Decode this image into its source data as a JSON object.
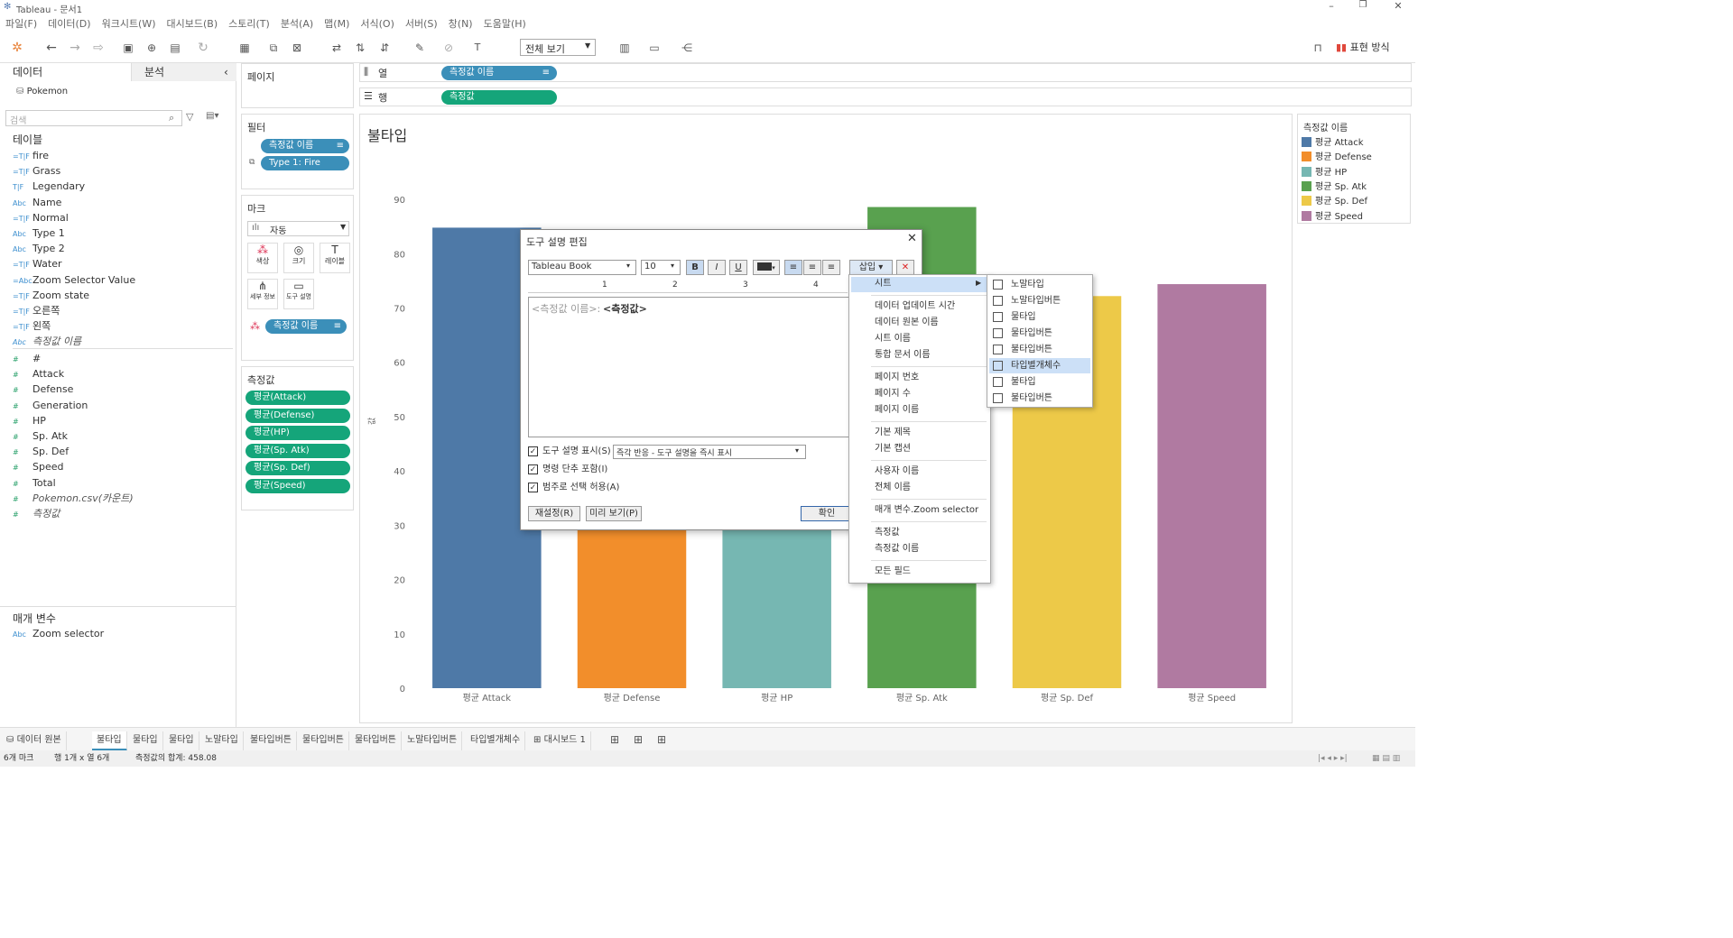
{
  "window": {
    "title": "Tableau - 문서1"
  },
  "menu": [
    "파일(F)",
    "데이터(D)",
    "워크시트(W)",
    "대시보드(B)",
    "스토리(T)",
    "분석(A)",
    "맵(M)",
    "서식(O)",
    "서버(S)",
    "창(N)",
    "도움말(H)"
  ],
  "toolbar": {
    "view_select": "전체 보기",
    "show_me": "표현 방식"
  },
  "left": {
    "tab_data": "데이터",
    "tab_analysis": "분석",
    "datasource": "Pokemon",
    "search_placeholder": "검색",
    "tables_header": "테이블",
    "dimensions": [
      {
        "icon": "=T|F",
        "label": "fire"
      },
      {
        "icon": "=T|F",
        "label": "Grass"
      },
      {
        "icon": "T|F",
        "label": "Legendary"
      },
      {
        "icon": "Abc",
        "label": "Name"
      },
      {
        "icon": "=T|F",
        "label": "Normal"
      },
      {
        "icon": "Abc",
        "label": "Type 1"
      },
      {
        "icon": "Abc",
        "label": "Type 2"
      },
      {
        "icon": "=T|F",
        "label": "Water"
      },
      {
        "icon": "=Abc",
        "label": "Zoom Selector Value"
      },
      {
        "icon": "=T|F",
        "label": "Zoom state"
      },
      {
        "icon": "=T|F",
        "label": "오른쪽"
      },
      {
        "icon": "=T|F",
        "label": "왼쪽"
      },
      {
        "icon": "Abc",
        "label": "측정값 이름"
      }
    ],
    "measures": [
      {
        "icon": "#",
        "label": "#"
      },
      {
        "icon": "#",
        "label": "Attack"
      },
      {
        "icon": "#",
        "label": "Defense"
      },
      {
        "icon": "#",
        "label": "Generation"
      },
      {
        "icon": "#",
        "label": "HP"
      },
      {
        "icon": "#",
        "label": "Sp. Atk"
      },
      {
        "icon": "#",
        "label": "Sp. Def"
      },
      {
        "icon": "#",
        "label": "Speed"
      },
      {
        "icon": "#",
        "label": "Total"
      },
      {
        "icon": "#",
        "label": "Pokemon.csv(카운트)"
      },
      {
        "icon": "#",
        "label": "측정값"
      }
    ],
    "params_header": "매개 변수",
    "param": {
      "icon": "Abc",
      "label": "Zoom selector"
    }
  },
  "pages": {
    "title": "페이지"
  },
  "filters": {
    "title": "필터",
    "pills": [
      "측정값 이름",
      "Type 1: Fire"
    ]
  },
  "marks": {
    "title": "마크",
    "type": "자동",
    "buttons": [
      "색상",
      "크기",
      "레이블",
      "세부 정보",
      "도구 설명"
    ],
    "pill": "측정값 이름"
  },
  "measure_values": {
    "title": "측정값",
    "pills": [
      "평균(Attack)",
      "평균(Defense)",
      "평균(HP)",
      "평균(Sp. Atk)",
      "평균(Sp. Def)",
      "평균(Speed)"
    ]
  },
  "shelves": {
    "columns_label": "열",
    "columns_pill": "측정값 이름",
    "rows_label": "행",
    "rows_pill": "측정값"
  },
  "sheet": {
    "title": "불타입",
    "axis_label": "값"
  },
  "chart_data": {
    "type": "bar",
    "title": "불타입",
    "categories": [
      "평균 Attack",
      "평균 Defense",
      "평균 HP",
      "평균 Sp. Atk",
      "평균 Sp. Def",
      "평균 Speed"
    ],
    "values": [
      84.8,
      67.8,
      69.9,
      88.6,
      72.2,
      74.4
    ],
    "colors": [
      "#4e79a7",
      "#f28e2b",
      "#76b7b2",
      "#59a14f",
      "#edc948",
      "#b07aa1"
    ],
    "ylabel": "값",
    "ylim": [
      0,
      95
    ],
    "yticks": [
      0,
      10,
      20,
      30,
      40,
      50,
      60,
      70,
      80,
      90
    ],
    "grid": false,
    "legend": "right"
  },
  "legend": {
    "title": "측정값 이름",
    "items": [
      {
        "label": "평균 Attack",
        "color": "#4e79a7"
      },
      {
        "label": "평균 Defense",
        "color": "#f28e2b"
      },
      {
        "label": "평균 HP",
        "color": "#76b7b2"
      },
      {
        "label": "평균 Sp. Atk",
        "color": "#59a14f"
      },
      {
        "label": "평균 Sp. Def",
        "color": "#edc948"
      },
      {
        "label": "평균 Speed",
        "color": "#b07aa1"
      }
    ]
  },
  "dialog": {
    "title": "도구 설명 편집",
    "font": "Tableau Book",
    "size": "10",
    "bold": "B",
    "italic": "I",
    "underline": "U",
    "insert": "삽입",
    "ruler": [
      "1",
      "2",
      "3",
      "4"
    ],
    "content_field": "<측정값 이름>:",
    "content_value": "<측정값>",
    "show_tooltip_label": "도구 설명 표시(S)",
    "show_tooltip_select": "즉각 반응 - 도구 설명을 즉시 표시",
    "include_commands_label": "명령 단추 포함(I)",
    "allow_select_label": "범주로 선택 허용(A)",
    "reset": "재설정(R)",
    "preview": "미리 보기(P)",
    "ok": "확인"
  },
  "insert_menu": {
    "groups": [
      [
        "시트"
      ],
      [
        "데이터 업데이트 시간",
        "데이터 원본 이름",
        "시트 이름",
        "통합 문서 이름"
      ],
      [
        "페이지 번호",
        "페이지 수",
        "페이지 이름"
      ],
      [
        "기본 제목",
        "기본 캡션"
      ],
      [
        "사용자 이름",
        "전체 이름"
      ],
      [
        "매개 변수.Zoom selector"
      ],
      [
        "측정값",
        "측정값 이름"
      ],
      [
        "모든 필드"
      ]
    ]
  },
  "sheet_submenu": [
    "노말타입",
    "노말타입버튼",
    "물타입",
    "물타입버튼",
    "불타입버튼",
    "타입별개체수",
    "불타입",
    "불타입버튼"
  ],
  "bottom_tabs": [
    "데이터 원본",
    "불타입",
    "물타입",
    "물타입",
    "노말타입",
    "불타입버튼",
    "물타입버튼",
    "물타입버튼",
    "노말타입버튼",
    "타입별개체수",
    "대시보드 1"
  ],
  "status": {
    "marks": "6개 마크",
    "rows_cols": "행 1개 x 열 6개",
    "sum": "측정값의 합계: 458.08"
  }
}
